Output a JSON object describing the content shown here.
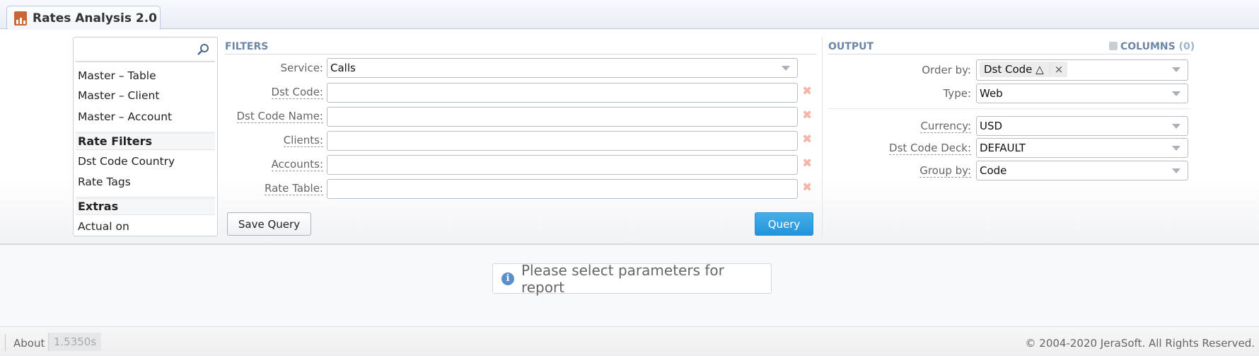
{
  "app": {
    "tab_title": "Rates Analysis 2.0"
  },
  "sidebar": {
    "search_placeholder": "",
    "items": [
      {
        "label": "Master – Table",
        "type": "item"
      },
      {
        "label": "Master – Client",
        "type": "item"
      },
      {
        "label": "Master – Account",
        "type": "item"
      },
      {
        "label": "Rate Filters",
        "type": "group"
      },
      {
        "label": "Dst Code Country",
        "type": "item"
      },
      {
        "label": "Rate Tags",
        "type": "item"
      },
      {
        "label": "Extras",
        "type": "group"
      },
      {
        "label": "Actual on",
        "type": "item"
      }
    ]
  },
  "filters": {
    "title": "FILTERS",
    "fields": [
      {
        "label": "Service:",
        "value": "Calls",
        "kind": "select"
      },
      {
        "label": "Dst Code:",
        "value": "",
        "kind": "text"
      },
      {
        "label": "Dst Code Name:",
        "value": "",
        "kind": "text"
      },
      {
        "label": "Clients:",
        "value": "",
        "kind": "text"
      },
      {
        "label": "Accounts:",
        "value": "",
        "kind": "text"
      },
      {
        "label": "Rate Table:",
        "value": "",
        "kind": "text"
      }
    ],
    "save_label": "Save Query",
    "query_label": "Query"
  },
  "output": {
    "title": "OUTPUT",
    "columns_label": "COLUMNS",
    "columns_count": "(0)",
    "order_by": {
      "label": "Order by:",
      "tag": "Dst Code △",
      "remove": "×"
    },
    "type": {
      "label": "Type:",
      "value": "Web"
    },
    "currency": {
      "label": "Currency:",
      "value": "USD"
    },
    "deck": {
      "label": "Dst Code Deck:",
      "value": "DEFAULT"
    },
    "group_by": {
      "label": "Group by:",
      "value": "Code"
    }
  },
  "message": "Please select parameters for report",
  "footer": {
    "about": "About",
    "time": "1.5350s",
    "copyright": "© 2004-2020 JeraSoft. All Rights Reserved."
  },
  "colors": {
    "accent": "#2a9be0",
    "section": "#6b86a8",
    "clear": "#f3b5a8"
  }
}
